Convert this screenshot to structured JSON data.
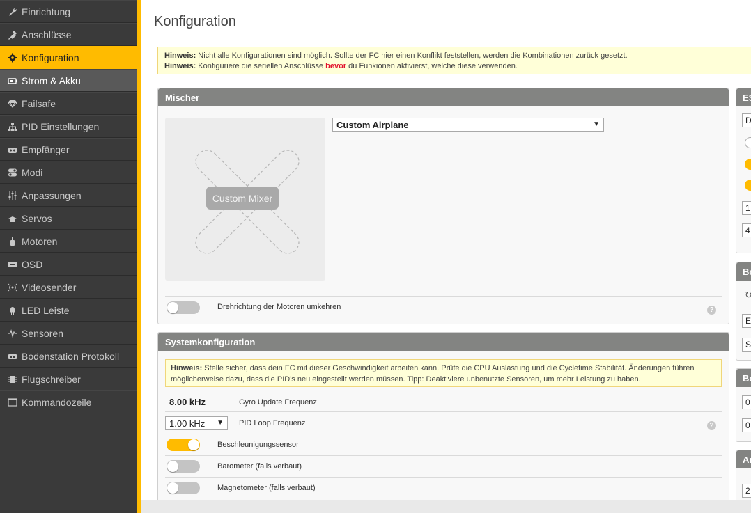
{
  "sidebar": {
    "items": [
      {
        "label": "Einrichtung",
        "icon": "wrench-icon",
        "state": "normal"
      },
      {
        "label": "Anschlüsse",
        "icon": "plug-icon",
        "state": "normal"
      },
      {
        "label": "Konfiguration",
        "icon": "gear-icon",
        "state": "active"
      },
      {
        "label": "Strom & Akku",
        "icon": "battery-icon",
        "state": "current"
      },
      {
        "label": "Failsafe",
        "icon": "parachute-icon",
        "state": "normal"
      },
      {
        "label": "PID Einstellungen",
        "icon": "sitemap-icon",
        "state": "normal"
      },
      {
        "label": "Empfänger",
        "icon": "remote-icon",
        "state": "normal"
      },
      {
        "label": "Modi",
        "icon": "toggles-icon",
        "state": "normal"
      },
      {
        "label": "Anpassungen",
        "icon": "sliders-icon",
        "state": "normal"
      },
      {
        "label": "Servos",
        "icon": "servo-icon",
        "state": "normal"
      },
      {
        "label": "Motoren",
        "icon": "motor-icon",
        "state": "normal"
      },
      {
        "label": "OSD",
        "icon": "osd-icon",
        "state": "normal"
      },
      {
        "label": "Videosender",
        "icon": "broadcast-icon",
        "state": "normal"
      },
      {
        "label": "LED Leiste",
        "icon": "led-icon",
        "state": "normal"
      },
      {
        "label": "Sensoren",
        "icon": "pulse-icon",
        "state": "normal"
      },
      {
        "label": "Bodenstation Protokoll",
        "icon": "ground-station-icon",
        "state": "normal"
      },
      {
        "label": "Flugschreiber",
        "icon": "blackbox-icon",
        "state": "normal"
      },
      {
        "label": "Kommandozeile",
        "icon": "terminal-icon",
        "state": "normal"
      }
    ]
  },
  "page": {
    "title": "Konfiguration"
  },
  "notice": {
    "line1_strong": "Hinweis:",
    "line1_text": " Nicht alle Konfigurationen sind möglich. Sollte der FC hier einen Konflikt feststellen, werden die Kombinationen zurück gesetzt.",
    "line2_strong": "Hinweis:",
    "line2_text_a": " Konfiguriere die seriellen Anschlüsse ",
    "line2_red": "bevor",
    "line2_text_b": " du Funkionen aktivierst, welche diese verwenden."
  },
  "mixer": {
    "title": "Mischer",
    "selected": "Custom Airplane",
    "preview_label": "Custom Mixer",
    "reverse_label": "Drehrichtung der Motoren umkehren",
    "reverse_on": false
  },
  "system": {
    "title": "Systemkonfiguration",
    "note_strong": "Hinweis:",
    "note_text": " Stelle sicher, dass dein FC mit dieser Geschwindigkeit arbeiten kann. Prüfe die CPU Auslastung und die Cycletime Stabilität. Änderungen führen möglicherweise dazu, dass die PID's neu eingestellt werden müssen. Tipp: Deaktiviere unbenutzte Sensoren, um mehr Leistung zu haben.",
    "gyro_value": "8.00 kHz",
    "gyro_label": "Gyro Update Frequenz",
    "pid_value": "1.00 kHz",
    "pid_label": "PID Loop Frequenz",
    "sensors": [
      {
        "label": "Beschleunigungssensor",
        "on": true
      },
      {
        "label": "Barometer (falls verbaut)",
        "on": false
      },
      {
        "label": "Magnetometer (falls verbaut)",
        "on": false
      }
    ]
  },
  "right_panels": {
    "esc_title": "ES",
    "esc_select": "D",
    "esc_input_1": "1",
    "esc_input_2": "4",
    "board_title": "Bo",
    "board_select_1": "E",
    "board_select_2": "S",
    "be_title": "Be",
    "be_input_1": "0",
    "be_input_2": "0",
    "an_title": "An",
    "an_input_1": "2"
  },
  "colors": {
    "accent": "#ffbb00",
    "sidebar_bg": "#3a3a3a",
    "panel_header": "#838482",
    "notice_bg": "#ffffd8",
    "warning_red": "#e2112d"
  }
}
